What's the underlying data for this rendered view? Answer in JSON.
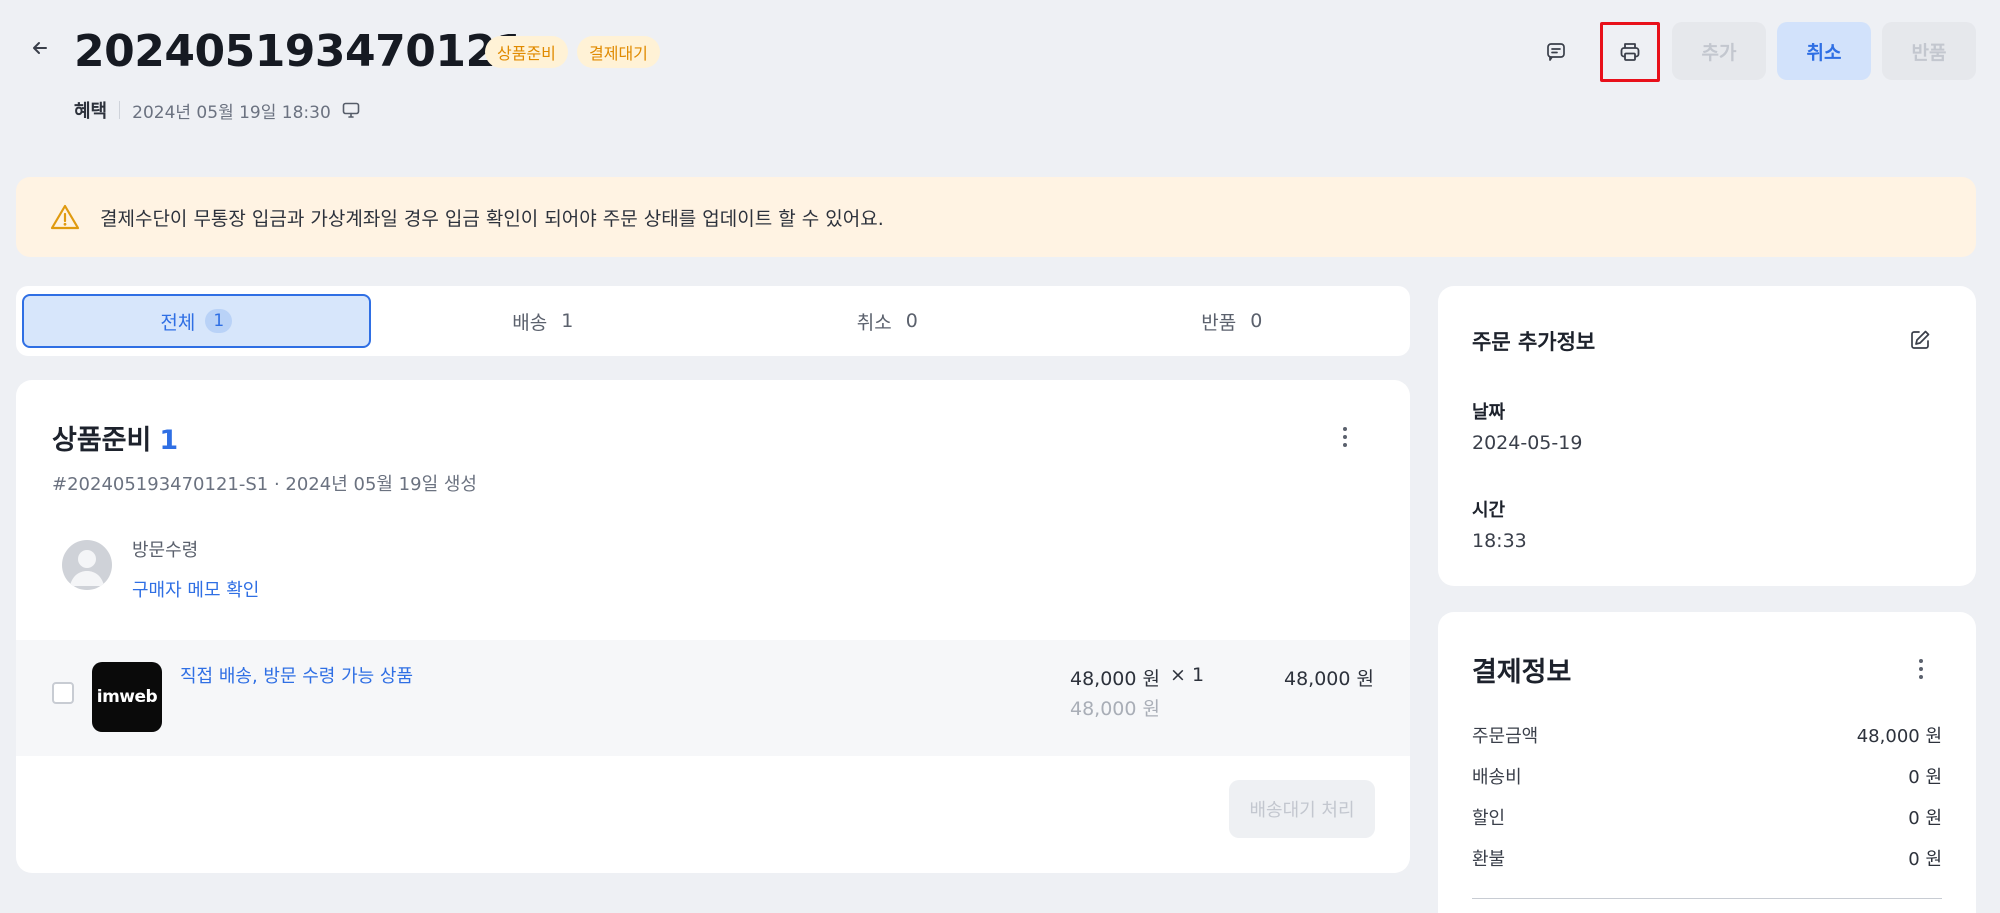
{
  "header": {
    "order_no": "202405193470121",
    "badges": [
      "상품준비",
      "결제대기"
    ],
    "channel": "혜택",
    "datetime": "2024년 05월 19일 18:30",
    "buttons": {
      "add": "추가",
      "cancel": "취소",
      "return": "반품"
    }
  },
  "alert": {
    "text": "결제수단이 무통장 입금과 가상계좌일 경우 입금 확인이 되어야 주문 상태를 업데이트 할 수 있어요."
  },
  "tabs": [
    {
      "label": "전체",
      "count": "1",
      "active": true
    },
    {
      "label": "배송",
      "count": "1",
      "active": false
    },
    {
      "label": "취소",
      "count": "0",
      "active": false
    },
    {
      "label": "반품",
      "count": "0",
      "active": false
    }
  ],
  "section": {
    "title": "상품준비",
    "count": "1",
    "subtitle": "#202405193470121-S1 · 2024년 05월 19일 생성",
    "receive_method": "방문수령",
    "memo_link": "구매자 메모 확인",
    "item": {
      "thumb_text": "imweb",
      "name": "직접 배송, 방문 수령 가능 상품",
      "price": "48,000 원",
      "qty": "× 1",
      "original_price": "48,000 원",
      "total": "48,000 원"
    },
    "ship_button": "배송대기 처리"
  },
  "extra_info": {
    "title": "주문 추가정보",
    "date_label": "날짜",
    "date_value": "2024-05-19",
    "time_label": "시간",
    "time_value": "18:33"
  },
  "payment": {
    "title": "결제정보",
    "rows": [
      {
        "label": "주문금액",
        "value": "48,000 원"
      },
      {
        "label": "배송비",
        "value": "0 원"
      },
      {
        "label": "할인",
        "value": "0 원"
      },
      {
        "label": "환불",
        "value": "0 원"
      }
    ]
  },
  "colors": {
    "accent": "#2f6fe4",
    "badge_bg": "#fff2d6",
    "badge_text": "#e08a00",
    "alert_bg": "#fff3e3",
    "highlight_border": "#e8101a"
  }
}
